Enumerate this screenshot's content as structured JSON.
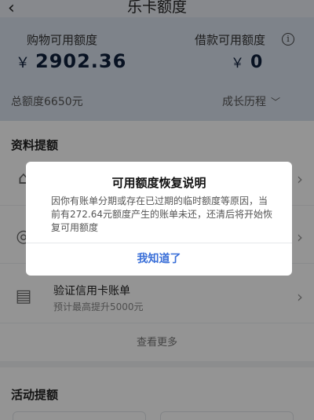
{
  "header": {
    "back_icon": "‹",
    "title": "乐卡额度"
  },
  "credit": {
    "shopping_label": "购物可用额度",
    "loan_label": "借款可用额度",
    "currency": "￥",
    "shopping_amount": "2902.36",
    "loan_amount": "0",
    "total_label": "总额度6650元",
    "history_label": "成长历程"
  },
  "materials": {
    "section_title": "资料提额",
    "rows": [
      {
        "title": "",
        "subtitle": ""
      },
      {
        "title": "",
        "subtitle": ""
      },
      {
        "title": "验证信用卡账单",
        "subtitle": "预计最高提升5000元"
      }
    ],
    "more_label": "查看更多"
  },
  "activity": {
    "section_title": "活动提额"
  },
  "dialog": {
    "title": "可用额度恢复说明",
    "body": "因你有账单分期或存在已过期的临时额度等原因，当前有272.64元额度产生的账单未还，还清后将开始恢复可用额度",
    "confirm_label": "我知道了"
  }
}
